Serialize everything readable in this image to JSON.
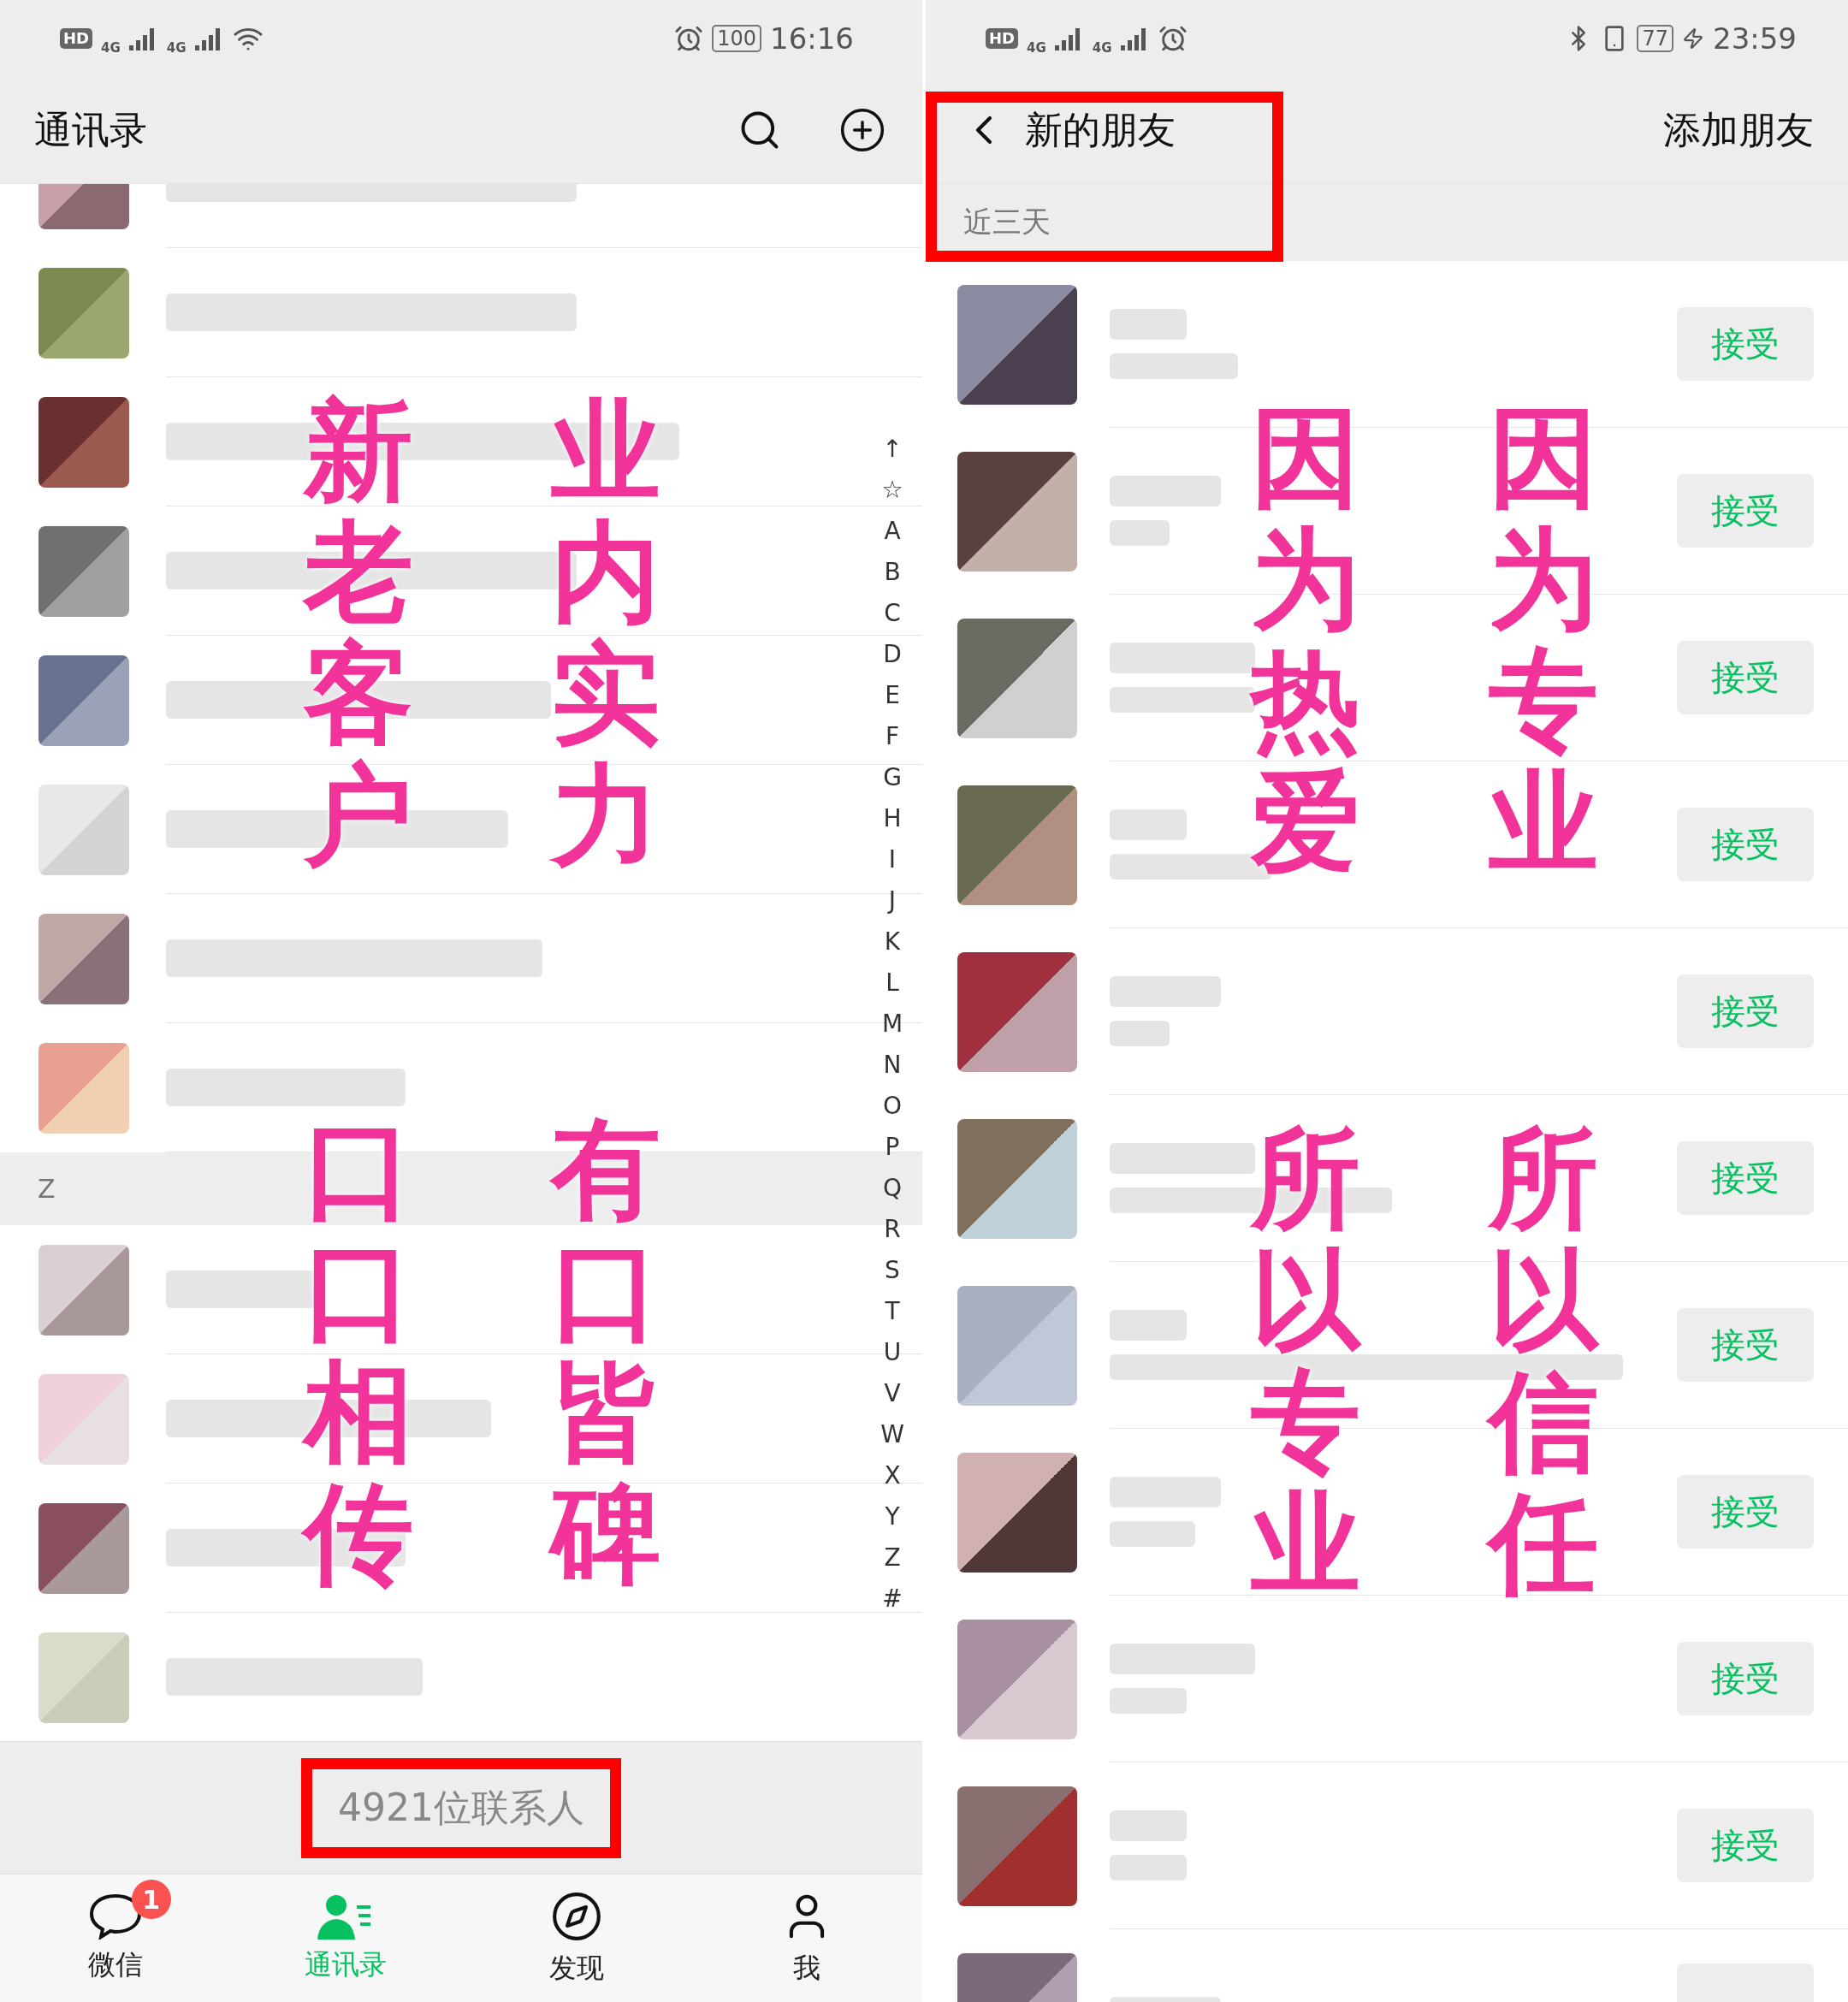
{
  "left_screen": {
    "status_bar": {
      "badge": "HD",
      "signal_1": "4G",
      "signal_2": "4G",
      "battery": "100",
      "time": "16:16"
    },
    "header": {
      "title": "通讯录"
    },
    "section": {
      "letter": "Z"
    },
    "index": [
      "↑",
      "☆",
      "A",
      "B",
      "C",
      "D",
      "E",
      "F",
      "G",
      "H",
      "I",
      "J",
      "K",
      "L",
      "M",
      "N",
      "O",
      "P",
      "Q",
      "R",
      "S",
      "T",
      "U",
      "V",
      "W",
      "X",
      "Y",
      "Z",
      "#"
    ],
    "contact_count": "4921位联系人",
    "tabs": [
      {
        "label": "微信",
        "selected": false,
        "badge": "1"
      },
      {
        "label": "通讯录",
        "selected": true
      },
      {
        "label": "发现",
        "selected": false
      },
      {
        "label": "我",
        "selected": false
      }
    ],
    "overlay": [
      "新老客户",
      "业内实力",
      "口口相传",
      "有口皆碑"
    ]
  },
  "right_screen": {
    "status_bar": {
      "badge": "HD",
      "signal_1": "4G",
      "signal_2": "4G",
      "battery": "77",
      "time": "23:59"
    },
    "header": {
      "title": "新的朋友",
      "action": "添加朋友"
    },
    "section": {
      "label": "近三天"
    },
    "requests": [
      {
        "button": "接受"
      },
      {
        "button": "接受"
      },
      {
        "button": "接受"
      },
      {
        "button": "接受"
      },
      {
        "button": "接受"
      },
      {
        "button": "接受"
      },
      {
        "button": "接受"
      },
      {
        "button": "接受"
      },
      {
        "button": "接受"
      },
      {
        "button": "接受"
      }
    ],
    "overlay": [
      "因为热爱",
      "因为专业",
      "所以专业",
      "所以信任"
    ]
  }
}
